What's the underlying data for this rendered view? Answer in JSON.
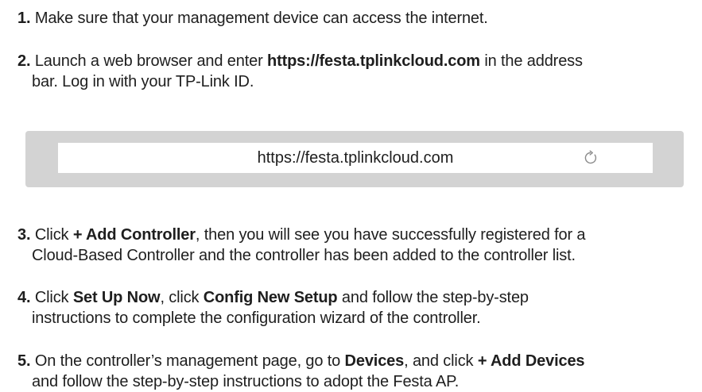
{
  "steps": [
    {
      "number": "1.",
      "line1": "Make sure that your management device can access the internet."
    },
    {
      "number": "2.",
      "t1": "Launch a web browser and enter ",
      "url": "https://festa.tplinkcloud.com",
      "t2": " in the address",
      "line2": "bar. Log in with your TP-Link ID."
    },
    {
      "number": "3.",
      "t1": "Click ",
      "b1": "+ Add Controller",
      "t2": ", then you will see you have successfully registered for a",
      "line2": "Cloud-Based Controller and the controller has been added to the controller list."
    },
    {
      "number": "4.",
      "t1": "Click ",
      "b1": "Set Up Now",
      "t2": ", click ",
      "b2": "Config New Setup",
      "t3": " and follow the step-by-step",
      "line2": "instructions to complete the configuration wizard of the controller."
    },
    {
      "number": "5.",
      "t1": "On the controller’s management page, go to ",
      "b1": "Devices",
      "t2": ", and click ",
      "b2": "+ Add Devices",
      "line2": "and follow the step-by-step instructions to adopt the Festa AP."
    }
  ],
  "browser": {
    "address": "https://festa.tplinkcloud.com",
    "reload_icon": "reload-icon"
  }
}
